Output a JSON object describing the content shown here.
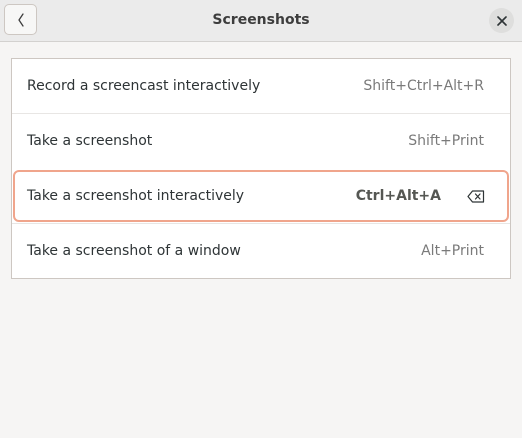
{
  "header": {
    "title": "Screenshots",
    "back_icon": "chevron-left-icon",
    "close_icon": "close-icon"
  },
  "shortcuts": [
    {
      "label": "Record a screencast interactively",
      "accel": "Shift+Ctrl+Alt+R"
    },
    {
      "label": "Take a screenshot",
      "accel": "Shift+Print"
    },
    {
      "label": "Take a screenshot interactively",
      "accel": "Ctrl+Alt+A",
      "editing": true,
      "clear_icon": "backspace-icon"
    },
    {
      "label": "Take a screenshot of a window",
      "accel": "Alt+Print"
    }
  ],
  "colors": {
    "focus_border": "#f0a58c",
    "background": "#f6f5f4",
    "header": "#ebebeb"
  }
}
